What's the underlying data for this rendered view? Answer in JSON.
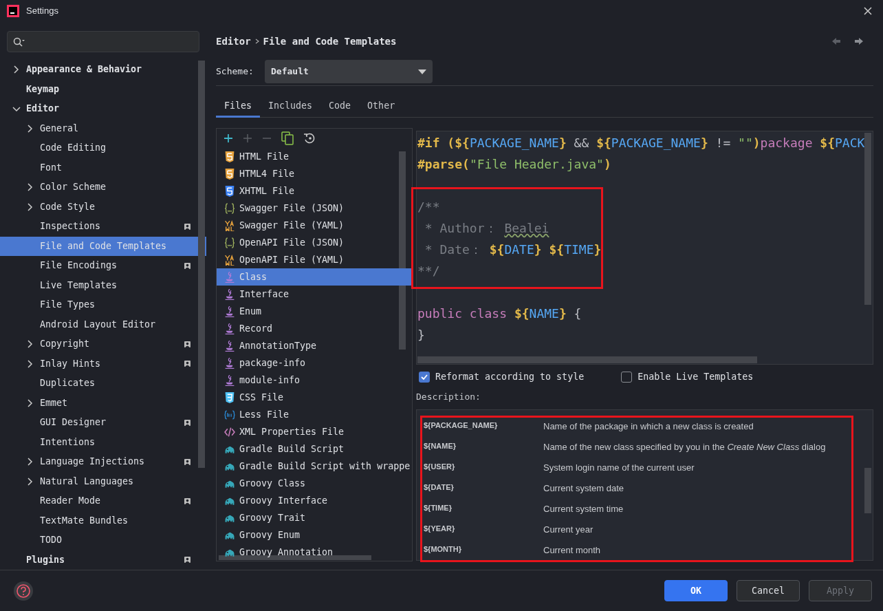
{
  "window": {
    "title": "Settings"
  },
  "sidebar": {
    "items": [
      {
        "label": "Appearance & Behavior",
        "kind": "group",
        "expanded": false,
        "selected": false,
        "badge": false
      },
      {
        "label": "Keymap",
        "kind": "leaf",
        "selected": false,
        "badge": false
      },
      {
        "label": "Editor",
        "kind": "group",
        "expanded": true,
        "selected": false,
        "badge": false,
        "children": [
          {
            "label": "General",
            "kind": "group",
            "expanded": false,
            "selected": false,
            "badge": false
          },
          {
            "label": "Code Editing",
            "kind": "leaf",
            "selected": false,
            "badge": false
          },
          {
            "label": "Font",
            "kind": "leaf",
            "selected": false,
            "badge": false
          },
          {
            "label": "Color Scheme",
            "kind": "group",
            "expanded": false,
            "selected": false,
            "badge": false
          },
          {
            "label": "Code Style",
            "kind": "group",
            "expanded": false,
            "selected": false,
            "badge": false
          },
          {
            "label": "Inspections",
            "kind": "leaf",
            "selected": false,
            "badge": true
          },
          {
            "label": "File and Code Templates",
            "kind": "leaf",
            "selected": true,
            "badge": false
          },
          {
            "label": "File Encodings",
            "kind": "leaf",
            "selected": false,
            "badge": true
          },
          {
            "label": "Live Templates",
            "kind": "leaf",
            "selected": false,
            "badge": false
          },
          {
            "label": "File Types",
            "kind": "leaf",
            "selected": false,
            "badge": false
          },
          {
            "label": "Android Layout Editor",
            "kind": "leaf",
            "selected": false,
            "badge": false
          },
          {
            "label": "Copyright",
            "kind": "group",
            "expanded": false,
            "selected": false,
            "badge": true
          },
          {
            "label": "Inlay Hints",
            "kind": "group",
            "expanded": false,
            "selected": false,
            "badge": true
          },
          {
            "label": "Duplicates",
            "kind": "leaf",
            "selected": false,
            "badge": false
          },
          {
            "label": "Emmet",
            "kind": "group",
            "expanded": false,
            "selected": false,
            "badge": false
          },
          {
            "label": "GUI Designer",
            "kind": "leaf",
            "selected": false,
            "badge": true
          },
          {
            "label": "Intentions",
            "kind": "leaf",
            "selected": false,
            "badge": false
          },
          {
            "label": "Language Injections",
            "kind": "group",
            "expanded": false,
            "selected": false,
            "badge": true
          },
          {
            "label": "Natural Languages",
            "kind": "group",
            "expanded": false,
            "selected": false,
            "badge": false
          },
          {
            "label": "Reader Mode",
            "kind": "leaf",
            "selected": false,
            "badge": true
          },
          {
            "label": "TextMate Bundles",
            "kind": "leaf",
            "selected": false,
            "badge": false
          },
          {
            "label": "TODO",
            "kind": "leaf",
            "selected": false,
            "badge": false
          }
        ]
      },
      {
        "label": "Plugins",
        "kind": "leaf",
        "selected": false,
        "badge": true
      }
    ]
  },
  "breadcrumb": [
    "Editor",
    "File and Code Templates"
  ],
  "scheme": {
    "label": "Scheme:",
    "value": "Default"
  },
  "tabs": [
    {
      "label": "Files",
      "selected": true
    },
    {
      "label": "Includes",
      "selected": false
    },
    {
      "label": "Code",
      "selected": false
    },
    {
      "label": "Other",
      "selected": false
    }
  ],
  "templates": [
    {
      "label": "HTML File",
      "kind": "html",
      "selected": false
    },
    {
      "label": "HTML4 File",
      "kind": "html",
      "selected": false
    },
    {
      "label": "XHTML File",
      "kind": "xhtml",
      "selected": false
    },
    {
      "label": "Swagger File (JSON)",
      "kind": "json",
      "selected": false
    },
    {
      "label": "Swagger File (YAML)",
      "kind": "yaml",
      "selected": false
    },
    {
      "label": "OpenAPI File (JSON)",
      "kind": "json",
      "selected": false
    },
    {
      "label": "OpenAPI File (YAML)",
      "kind": "yaml",
      "selected": false
    },
    {
      "label": "Class",
      "kind": "java",
      "selected": true
    },
    {
      "label": "Interface",
      "kind": "java",
      "selected": false
    },
    {
      "label": "Enum",
      "kind": "java",
      "selected": false
    },
    {
      "label": "Record",
      "kind": "java",
      "selected": false
    },
    {
      "label": "AnnotationType",
      "kind": "java",
      "selected": false
    },
    {
      "label": "package-info",
      "kind": "java",
      "selected": false
    },
    {
      "label": "module-info",
      "kind": "java",
      "selected": false
    },
    {
      "label": "CSS File",
      "kind": "css",
      "selected": false
    },
    {
      "label": "Less File",
      "kind": "less",
      "selected": false
    },
    {
      "label": "XML Properties File",
      "kind": "xml",
      "selected": false
    },
    {
      "label": "Gradle Build Script",
      "kind": "groovy",
      "selected": false
    },
    {
      "label": "Gradle Build Script with wrappe",
      "kind": "groovy",
      "selected": false
    },
    {
      "label": "Groovy Class",
      "kind": "groovy",
      "selected": false
    },
    {
      "label": "Groovy Interface",
      "kind": "groovy",
      "selected": false
    },
    {
      "label": "Groovy Trait",
      "kind": "groovy",
      "selected": false
    },
    {
      "label": "Groovy Enum",
      "kind": "groovy",
      "selected": false
    },
    {
      "label": "Groovy Annotation",
      "kind": "groovy",
      "selected": false
    }
  ],
  "code": [
    {
      "kind": "code",
      "marked": false,
      "tokens": [
        {
          "kind": "directive",
          "text": "#if "
        },
        {
          "kind": "brace",
          "text": "("
        },
        {
          "kind": "brace",
          "text": "${"
        },
        {
          "kind": "ident",
          "text": "PACKAGE_NAME"
        },
        {
          "kind": "brace",
          "text": "}"
        },
        {
          "kind": "plain",
          "text": " && "
        },
        {
          "kind": "brace",
          "text": "${"
        },
        {
          "kind": "ident",
          "text": "PACKAGE_NAME"
        },
        {
          "kind": "brace",
          "text": "}"
        },
        {
          "kind": "plain",
          "text": " != "
        },
        {
          "kind": "string",
          "text": "\"\""
        },
        {
          "kind": "brace",
          "text": ")"
        },
        {
          "kind": "keyword",
          "text": "package "
        },
        {
          "kind": "brace",
          "text": "${"
        },
        {
          "kind": "ident",
          "text": "PACK"
        }
      ]
    },
    {
      "kind": "code",
      "marked": false,
      "tokens": [
        {
          "kind": "directive",
          "text": "#parse"
        },
        {
          "kind": "brace",
          "text": "("
        },
        {
          "kind": "string",
          "text": "\"File Header.java\""
        },
        {
          "kind": "brace",
          "text": ")"
        }
      ]
    },
    {
      "kind": "blank",
      "marked": false
    },
    {
      "kind": "code",
      "marked": true,
      "tokens": [
        {
          "kind": "comment",
          "text": "/**"
        }
      ]
    },
    {
      "kind": "code",
      "marked": true,
      "tokens": [
        {
          "kind": "comment",
          "text": " * Author： "
        },
        {
          "kind": "typo",
          "text": "Bealei"
        }
      ]
    },
    {
      "kind": "code",
      "marked": true,
      "tokens": [
        {
          "kind": "comment",
          "text": " * Date： "
        },
        {
          "kind": "brace",
          "text": "${"
        },
        {
          "kind": "ident",
          "text": "DATE"
        },
        {
          "kind": "brace",
          "text": "} "
        },
        {
          "kind": "brace",
          "text": "${"
        },
        {
          "kind": "ident",
          "text": "TIME"
        },
        {
          "kind": "brace",
          "text": "}"
        }
      ]
    },
    {
      "kind": "code",
      "marked": true,
      "tokens": [
        {
          "kind": "comment",
          "text": "**/"
        }
      ]
    },
    {
      "kind": "blank",
      "marked": false
    },
    {
      "kind": "code",
      "marked": false,
      "tokens": [
        {
          "kind": "keyword",
          "text": "public "
        },
        {
          "kind": "keyword",
          "text": "class "
        },
        {
          "kind": "brace",
          "text": "${"
        },
        {
          "kind": "ident",
          "text": "NAME"
        },
        {
          "kind": "brace",
          "text": "}"
        },
        {
          "kind": "plain",
          "text": " {"
        }
      ]
    },
    {
      "kind": "code",
      "marked": false,
      "tokens": [
        {
          "kind": "plain",
          "text": "}"
        }
      ]
    }
  ],
  "options": [
    {
      "label": "Reformat according to style",
      "checked": true
    },
    {
      "label": "Enable Live Templates",
      "checked": false
    }
  ],
  "description": {
    "label": "Description:",
    "marked": true,
    "rows": [
      {
        "variable": "${PACKAGE_NAME}",
        "text": "Name of the package in which a new class is created"
      },
      {
        "variable": "${NAME}",
        "text": "Name of the new class specified by you in the *Create New Class* dialog"
      },
      {
        "variable": "${USER}",
        "text": "System login name of the current user"
      },
      {
        "variable": "${DATE}",
        "text": "Current system date"
      },
      {
        "variable": "${TIME}",
        "text": "Current system time"
      },
      {
        "variable": "${YEAR}",
        "text": "Current year"
      },
      {
        "variable": "${MONTH}",
        "text": "Current month"
      }
    ]
  },
  "buttons": [
    {
      "label": "OK",
      "kind": "primary",
      "disabled": false
    },
    {
      "label": "Cancel",
      "kind": "secondary",
      "disabled": false
    },
    {
      "label": "Apply",
      "kind": "secondary",
      "disabled": true
    }
  ]
}
